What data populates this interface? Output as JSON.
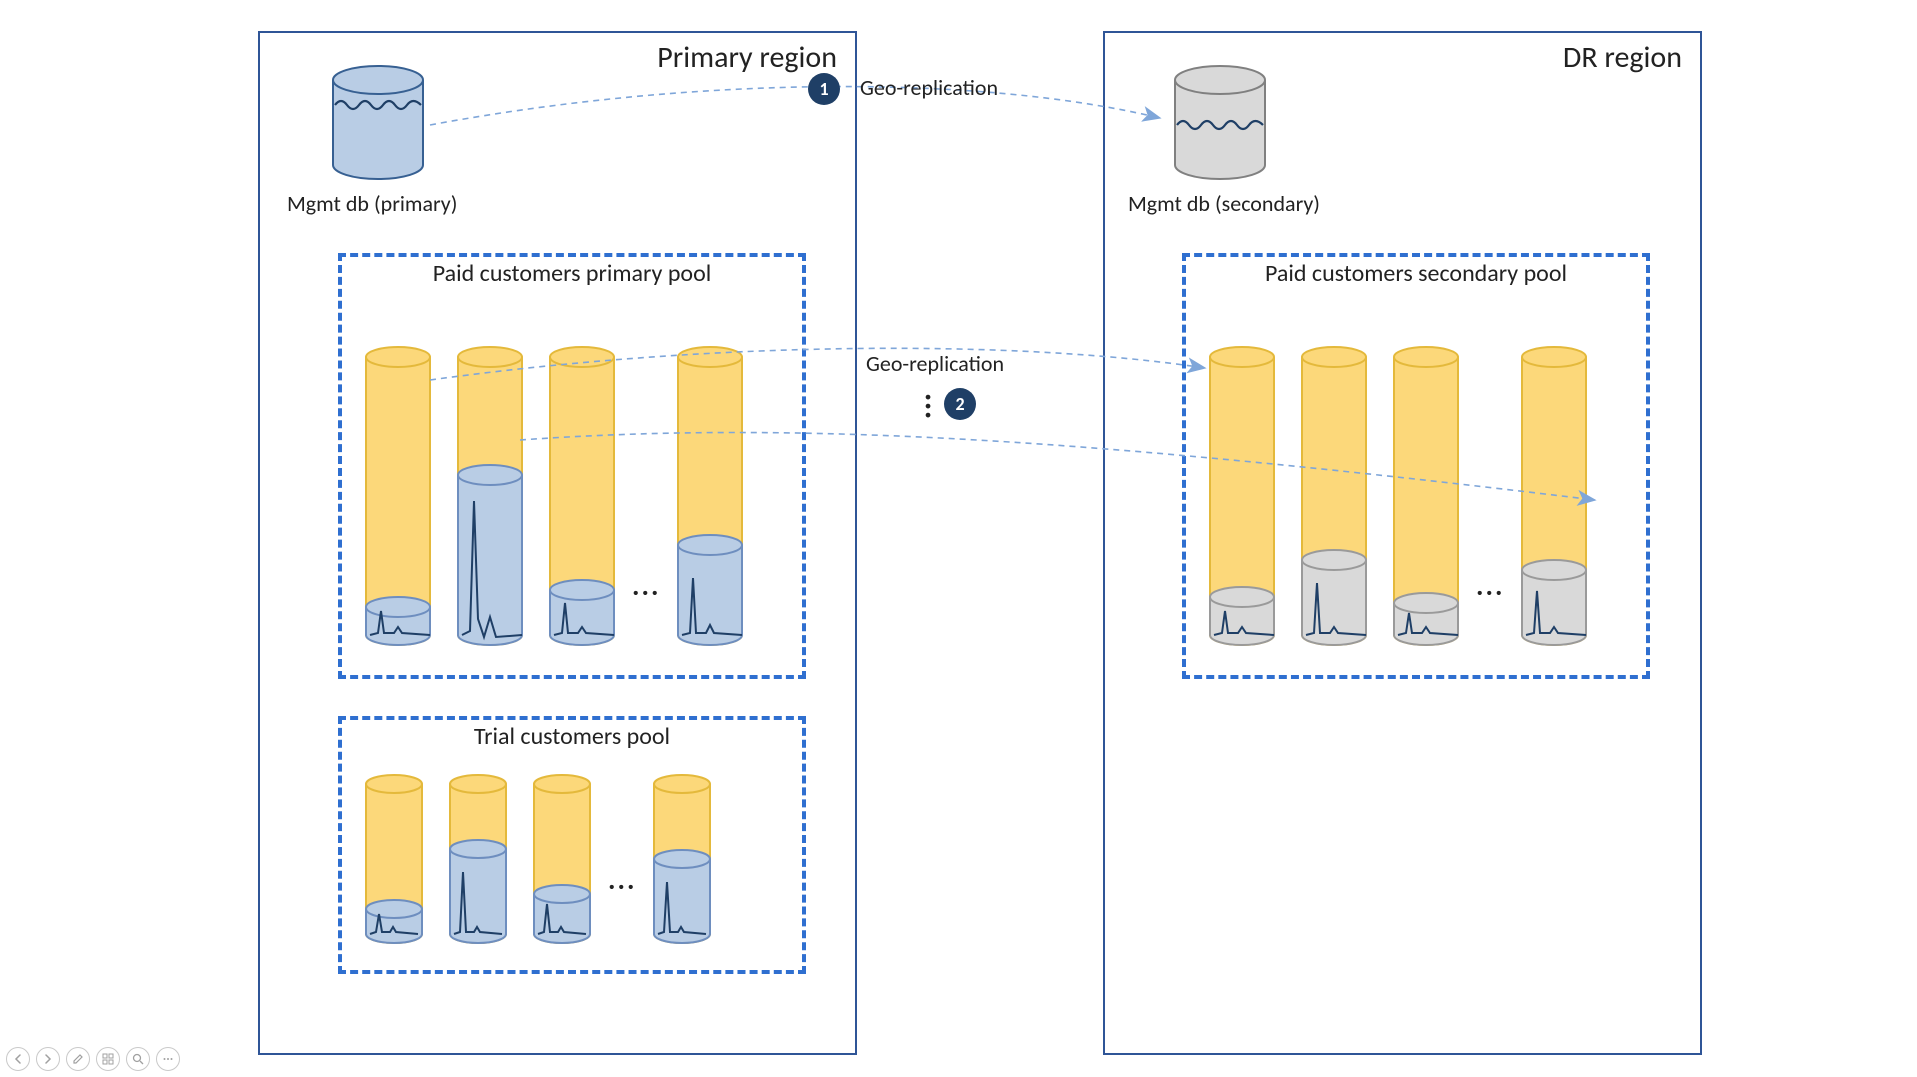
{
  "regions": {
    "primary": {
      "title": "Primary region"
    },
    "dr": {
      "title": "DR region"
    }
  },
  "databases": {
    "primary": {
      "label": "Mgmt db (primary)"
    },
    "secondary": {
      "label": "Mgmt db (secondary)"
    }
  },
  "pools": {
    "paid_primary": {
      "title": "Paid customers primary pool"
    },
    "paid_secondary": {
      "title": "Paid customers secondary pool"
    },
    "trial": {
      "title": "Trial customers pool"
    }
  },
  "replication": {
    "mgmt": {
      "label": "Geo-replication",
      "badge": "1"
    },
    "pool": {
      "label": "Geo-replication",
      "badge": "2"
    }
  },
  "toolbar": {
    "prev": "Previous",
    "next": "Next",
    "pen": "Pen",
    "view": "View",
    "zoom": "Zoom",
    "more": "More"
  }
}
